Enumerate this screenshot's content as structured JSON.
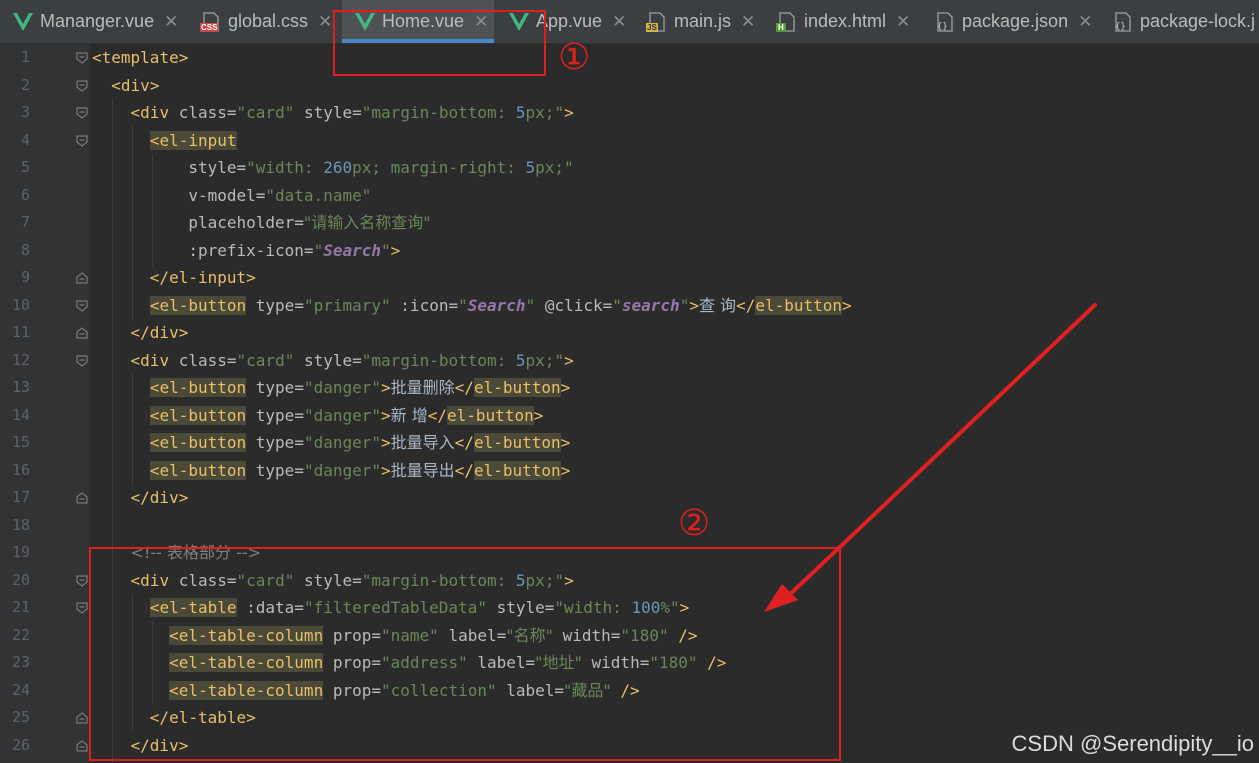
{
  "tabs": [
    {
      "label": "Mananger.vue",
      "icon": "vue-icon",
      "active": false
    },
    {
      "label": "global.css",
      "icon": "css-file-icon",
      "active": false
    },
    {
      "label": "Home.vue",
      "icon": "vue-icon",
      "active": true
    },
    {
      "label": "App.vue",
      "icon": "vue-icon",
      "active": false
    },
    {
      "label": "main.js",
      "icon": "js-file-icon",
      "active": false
    },
    {
      "label": "index.html",
      "icon": "html-file-icon",
      "active": false
    },
    {
      "label": "package.json",
      "icon": "json-file-icon",
      "active": false
    },
    {
      "label": "package-lock.j",
      "icon": "json-file-icon",
      "active": false
    }
  ],
  "icon_badges": {
    "css": "CSS",
    "js": "JS",
    "html": "H"
  },
  "line_numbers": [
    "1",
    "2",
    "3",
    "4",
    "5",
    "6",
    "7",
    "8",
    "9",
    "10",
    "11",
    "12",
    "13",
    "14",
    "15",
    "16",
    "17",
    "18",
    "19",
    "20",
    "21",
    "22",
    "23",
    "24",
    "25",
    "26"
  ],
  "code": {
    "l1": {
      "a": "template"
    },
    "l2": {
      "a": "div"
    },
    "l3": {
      "a": "div",
      "b": "class",
      "c": "\"card\"",
      "d": "style",
      "e": "\"margin-bottom: ",
      "f": "5",
      "g": "px;\""
    },
    "l4": {
      "a": "el-input"
    },
    "l5": {
      "a": "style=",
      "b": "\"width: ",
      "c": "260",
      "d": "px; margin-right: ",
      "e": "5",
      "f": "px;\""
    },
    "l6": {
      "a": "v-model=",
      "b": "\"data.name\""
    },
    "l7": {
      "a": "placeholder=",
      "b": "\"请输入名称查询\""
    },
    "l8": {
      "a": ":prefix-icon=",
      "b": "\"",
      "c": "Search",
      "d": "\""
    },
    "l9": {
      "a": "el-input"
    },
    "l10": {
      "a": "el-button",
      "b": "type=",
      "c": "\"primary\"",
      "d": ":icon=",
      "e": "\"",
      "f": "Search",
      "g": "\"",
      "h": "@click=",
      "i": "\"",
      "j": "search",
      "k": "\"",
      "l": "查 询",
      "m": "el-button"
    },
    "l11": {
      "a": "div"
    },
    "l12": {
      "a": "div",
      "b": "class",
      "c": "\"card\"",
      "d": "style",
      "e": "\"margin-bottom: ",
      "f": "5",
      "g": "px;\""
    },
    "l13": {
      "a": "el-button",
      "b": "type=",
      "c": "\"danger\"",
      "d": "批量删除",
      "e": "el-button"
    },
    "l14": {
      "a": "el-button",
      "b": "type=",
      "c": "\"danger\"",
      "d": "新 增",
      "e": "el-button"
    },
    "l15": {
      "a": "el-button",
      "b": "type=",
      "c": "\"danger\"",
      "d": "批量导入",
      "e": "el-button"
    },
    "l16": {
      "a": "el-button",
      "b": "type=",
      "c": "\"danger\"",
      "d": "批量导出",
      "e": "el-button"
    },
    "l17": {
      "a": "div"
    },
    "l19": {
      "a": "<!-- 表格部分 -->"
    },
    "l20": {
      "a": "div",
      "b": "class",
      "c": "\"card\"",
      "d": "style",
      "e": "\"margin-bottom: ",
      "f": "5",
      "g": "px;\""
    },
    "l21": {
      "a": "el-table",
      "b": ":data=",
      "c": "\"filteredTableData\"",
      "d": "style=",
      "e": "\"width: ",
      "f": "100",
      "g": "%\""
    },
    "l22": {
      "a": "el-table-column",
      "b": "prop=",
      "c": "\"name\"",
      "d": "label=",
      "e": "\"名称\"",
      "f": "width=",
      "g": "\"180\""
    },
    "l23": {
      "a": "el-table-column",
      "b": "prop=",
      "c": "\"address\"",
      "d": "label=",
      "e": "\"地址\"",
      "f": "width=",
      "g": "\"180\""
    },
    "l24": {
      "a": "el-table-column",
      "b": "prop=",
      "c": "\"collection\"",
      "d": "label=",
      "e": "\"藏品\""
    },
    "l25": {
      "a": "el-table"
    },
    "l26": {
      "a": "div"
    }
  },
  "annotations": {
    "marker1": "①",
    "marker2": "②",
    "arrow_color": "#e02020"
  },
  "watermark": "CSDN @Serendipity__io",
  "colors": {
    "background": "#2b2b2b",
    "gutter": "#313335",
    "tag": "#e8bf6a",
    "string": "#6a8759",
    "number": "#6897bb",
    "keyword": "#9876aa",
    "comment": "#808080",
    "active_tab_underline": "#4a88c7"
  }
}
